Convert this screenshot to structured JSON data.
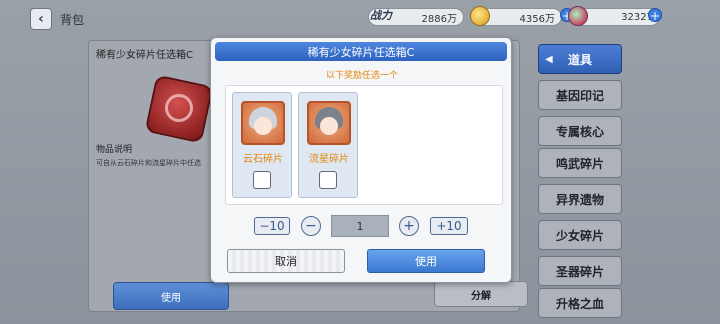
{
  "topbar": {
    "back_icon": "chevron-left-icon",
    "title": "背包",
    "power_label": "战力",
    "power_value": "2886万",
    "gold_value": "4356万",
    "gem_value": "32327"
  },
  "background": {
    "item_name": "稀有少女碎片任选箱C",
    "desc_label": "物品说明",
    "desc_text": "可自从云石碎片和流星碎片中任选",
    "use_label": "使用",
    "split_label": "分解"
  },
  "categories": [
    {
      "label": "道具",
      "active": true
    },
    {
      "label": "基因印记",
      "active": false
    },
    {
      "label": "专属核心",
      "active": false
    },
    {
      "label": "鸣武碎片",
      "active": false
    },
    {
      "label": "异界遗物",
      "active": false
    },
    {
      "label": "少女碎片",
      "active": false
    },
    {
      "label": "圣器碎片",
      "active": false
    },
    {
      "label": "升格之血",
      "active": false
    }
  ],
  "modal": {
    "title": "稀有少女碎片任选箱C",
    "subtitle": "以下奖励任选一个",
    "options": [
      {
        "name": "云石碎片",
        "checked": false
      },
      {
        "name": "流星碎片",
        "checked": false
      }
    ],
    "minus10_label": "−10",
    "plus10_label": "+10",
    "minus_label": "−",
    "plus_label": "+",
    "quantity": "1",
    "cancel_label": "取消",
    "confirm_label": "使用"
  },
  "colors": {
    "accent_blue": "#3d6fbe",
    "highlight_orange": "#e2870c"
  }
}
